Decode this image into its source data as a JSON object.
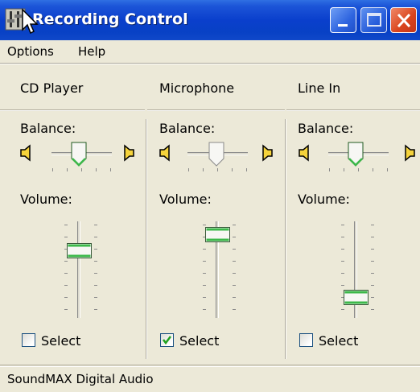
{
  "window": {
    "title": "Recording Control",
    "icon": "mixer-app-icon",
    "controls": [
      "minimize-icon",
      "maximize-icon",
      "close-icon"
    ]
  },
  "menu": {
    "options_label": "Options",
    "help_label": "Help"
  },
  "channels": [
    {
      "name": "CD Player",
      "balance_label": "Balance:",
      "balance_value": 0.5,
      "volume_label": "Volume:",
      "volume_level": 0.73,
      "select_label": "Select",
      "selected": false
    },
    {
      "name": "Microphone",
      "balance_label": "Balance:",
      "balance_value": 0.5,
      "volume_label": "Volume:",
      "volume_level": 0.93,
      "select_label": "Select",
      "selected": true
    },
    {
      "name": "Line In",
      "balance_label": "Balance:",
      "balance_value": 0.5,
      "volume_label": "Volume:",
      "volume_level": 0.16,
      "select_label": "Select",
      "selected": false
    }
  ],
  "status": {
    "text": "SoundMAX Digital Audio"
  },
  "colors": {
    "titlebar": "#0a3fcc",
    "face": "#ece9d8",
    "thumb_accent": "#3cb84a",
    "close": "#d9431c",
    "check": "#21a121"
  }
}
